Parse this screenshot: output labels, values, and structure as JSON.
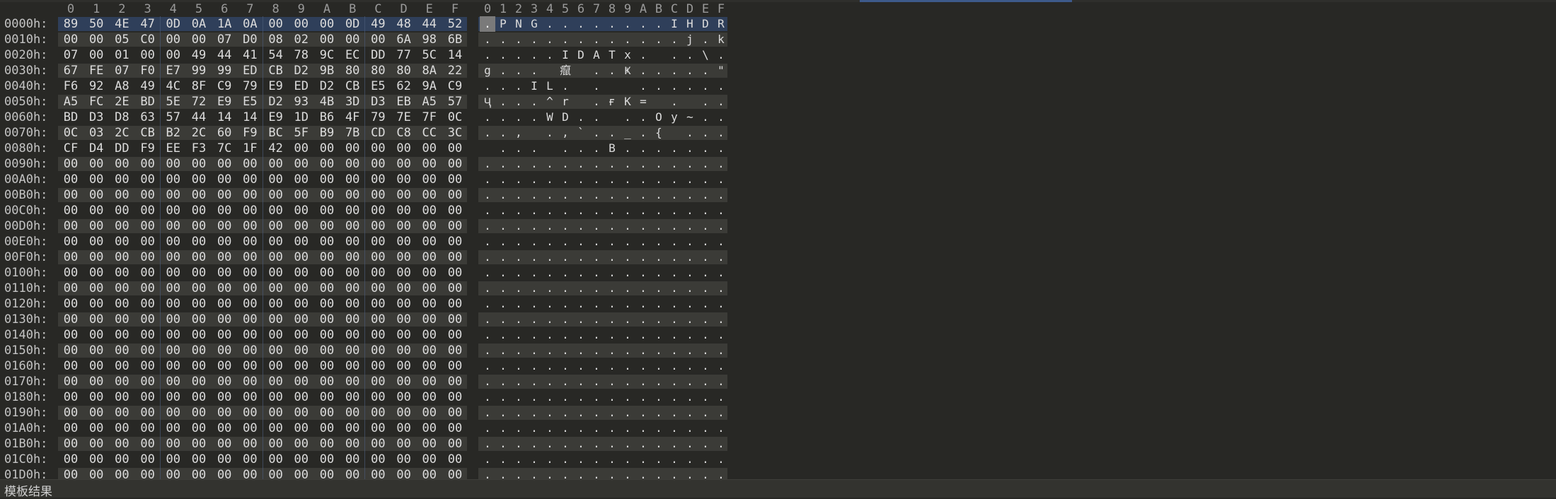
{
  "hex_columns": [
    "0",
    "1",
    "2",
    "3",
    "4",
    "5",
    "6",
    "7",
    "8",
    "9",
    "A",
    "B",
    "C",
    "D",
    "E",
    "F"
  ],
  "ascii_columns": [
    "0",
    "1",
    "2",
    "3",
    "4",
    "5",
    "6",
    "7",
    "8",
    "9",
    "A",
    "B",
    "C",
    "D",
    "E",
    "F"
  ],
  "rows": [
    {
      "offset": "0000h:",
      "bytes": [
        "89",
        "50",
        "4E",
        "47",
        "0D",
        "0A",
        "1A",
        "0A",
        "00",
        "00",
        "00",
        "0D",
        "49",
        "48",
        "44",
        "52"
      ],
      "ascii": [
        ".",
        " P",
        "N",
        "G",
        ".",
        ".",
        ".",
        ".",
        ".",
        ".",
        ".",
        ".",
        "I",
        "H",
        "D",
        "R"
      ]
    },
    {
      "offset": "0010h:",
      "bytes": [
        "00",
        "00",
        "05",
        "C0",
        "00",
        "00",
        "07",
        "D0",
        "08",
        "02",
        "00",
        "00",
        "00",
        "6A",
        "98",
        "6B"
      ],
      "ascii": [
        ".",
        ".",
        ".",
        ".",
        ".",
        ".",
        ".",
        ".",
        ".",
        ".",
        ".",
        ".",
        ".",
        "j",
        ".",
        "k"
      ]
    },
    {
      "offset": "0020h:",
      "bytes": [
        "07",
        "00",
        "01",
        "00",
        "00",
        "49",
        "44",
        "41",
        "54",
        "78",
        "9C",
        "EC",
        "DD",
        "77",
        "5C",
        "14"
      ],
      "ascii": [
        ".",
        ".",
        ".",
        ".",
        ".",
        "I",
        "D",
        "A",
        "T",
        "x",
        ".",
        "",
        ".",
        ".",
        "\\",
        "."
      ]
    },
    {
      "offset": "0030h:",
      "bytes": [
        "67",
        "FE",
        "07",
        "F0",
        "E7",
        "99",
        "99",
        "ED",
        "CB",
        "D2",
        "9B",
        "80",
        "80",
        "80",
        "8A",
        "22"
      ],
      "ascii": [
        "g",
        ".",
        ".",
        ".",
        "",
        "癙",
        "",
        ".",
        ".",
        "Ҝ",
        ".",
        ".",
        ".",
        ".",
        ".",
        "\""
      ]
    },
    {
      "offset": "0040h:",
      "bytes": [
        "F6",
        "92",
        "A8",
        "49",
        "4C",
        "8F",
        "C9",
        "79",
        "E9",
        "ED",
        "D2",
        "CB",
        "E5",
        "62",
        "9A",
        "C9"
      ],
      "ascii": [
        ".",
        ".",
        ".",
        "I",
        "L",
        ".",
        "",
        ".",
        "",
        "",
        ".",
        ".",
        ".",
        ".",
        ".",
        "."
      ]
    },
    {
      "offset": "0050h:",
      "bytes": [
        "A5",
        "FC",
        "2E",
        "BD",
        "5E",
        "72",
        "E9",
        "E5",
        "D2",
        "93",
        "4B",
        "3D",
        "D3",
        "EB",
        "A5",
        "57"
      ],
      "ascii": [
        "Ҷ",
        ".",
        ".",
        ".",
        "^",
        "r",
        "",
        ".",
        "ғ",
        "K",
        "=",
        "",
        ".",
        "",
        ".",
        "."
      ]
    },
    {
      "offset": "0060h:",
      "bytes": [
        "BD",
        "D3",
        "D8",
        "63",
        "57",
        "44",
        "14",
        "14",
        "E9",
        "1D",
        "B6",
        "4F",
        "79",
        "7E",
        "7F",
        "0C"
      ],
      "ascii": [
        ".",
        ".",
        ".",
        ".",
        "W",
        "D",
        ".",
        ".",
        "",
        ".",
        ".",
        "O",
        "y",
        "~",
        ".",
        "."
      ]
    },
    {
      "offset": "0070h:",
      "bytes": [
        "0C",
        "03",
        "2C",
        "CB",
        "B2",
        "2C",
        "60",
        "F9",
        "BC",
        "5F",
        "B9",
        "7B",
        "CD",
        "C8",
        "CC",
        "3C"
      ],
      "ascii": [
        ".",
        ".",
        ",",
        "",
        ".",
        ",",
        "`",
        ".",
        ".",
        "_",
        ".",
        "{",
        "",
        ".",
        ".",
        "."
      ]
    },
    {
      "offset": "0080h:",
      "bytes": [
        "CF",
        "D4",
        "DD",
        "F9",
        "EE",
        "F3",
        "7C",
        "1F",
        "42",
        "00",
        "00",
        "00",
        "00",
        "00",
        "00",
        "00"
      ],
      "ascii": [
        "",
        ".",
        ".",
        ".",
        "",
        ".",
        ".",
        ".",
        "B",
        ".",
        ".",
        ".",
        ".",
        ".",
        ".",
        "."
      ]
    },
    {
      "offset": "0090h:",
      "bytes": [
        "00",
        "00",
        "00",
        "00",
        "00",
        "00",
        "00",
        "00",
        "00",
        "00",
        "00",
        "00",
        "00",
        "00",
        "00",
        "00"
      ],
      "ascii": [
        ".",
        ".",
        ".",
        ".",
        ".",
        ".",
        ".",
        ".",
        ".",
        ".",
        ".",
        ".",
        ".",
        ".",
        ".",
        "."
      ]
    },
    {
      "offset": "00A0h:",
      "bytes": [
        "00",
        "00",
        "00",
        "00",
        "00",
        "00",
        "00",
        "00",
        "00",
        "00",
        "00",
        "00",
        "00",
        "00",
        "00",
        "00"
      ],
      "ascii": [
        ".",
        ".",
        ".",
        ".",
        ".",
        ".",
        ".",
        ".",
        ".",
        ".",
        ".",
        ".",
        ".",
        ".",
        ".",
        "."
      ]
    },
    {
      "offset": "00B0h:",
      "bytes": [
        "00",
        "00",
        "00",
        "00",
        "00",
        "00",
        "00",
        "00",
        "00",
        "00",
        "00",
        "00",
        "00",
        "00",
        "00",
        "00"
      ],
      "ascii": [
        ".",
        ".",
        ".",
        ".",
        ".",
        ".",
        ".",
        ".",
        ".",
        ".",
        ".",
        ".",
        ".",
        ".",
        ".",
        "."
      ]
    },
    {
      "offset": "00C0h:",
      "bytes": [
        "00",
        "00",
        "00",
        "00",
        "00",
        "00",
        "00",
        "00",
        "00",
        "00",
        "00",
        "00",
        "00",
        "00",
        "00",
        "00"
      ],
      "ascii": [
        ".",
        ".",
        ".",
        ".",
        ".",
        ".",
        ".",
        ".",
        ".",
        ".",
        ".",
        ".",
        ".",
        ".",
        ".",
        "."
      ]
    },
    {
      "offset": "00D0h:",
      "bytes": [
        "00",
        "00",
        "00",
        "00",
        "00",
        "00",
        "00",
        "00",
        "00",
        "00",
        "00",
        "00",
        "00",
        "00",
        "00",
        "00"
      ],
      "ascii": [
        ".",
        ".",
        ".",
        ".",
        ".",
        ".",
        ".",
        ".",
        ".",
        ".",
        ".",
        ".",
        ".",
        ".",
        ".",
        "."
      ]
    },
    {
      "offset": "00E0h:",
      "bytes": [
        "00",
        "00",
        "00",
        "00",
        "00",
        "00",
        "00",
        "00",
        "00",
        "00",
        "00",
        "00",
        "00",
        "00",
        "00",
        "00"
      ],
      "ascii": [
        ".",
        ".",
        ".",
        ".",
        ".",
        ".",
        ".",
        ".",
        ".",
        ".",
        ".",
        ".",
        ".",
        ".",
        ".",
        "."
      ]
    },
    {
      "offset": "00F0h:",
      "bytes": [
        "00",
        "00",
        "00",
        "00",
        "00",
        "00",
        "00",
        "00",
        "00",
        "00",
        "00",
        "00",
        "00",
        "00",
        "00",
        "00"
      ],
      "ascii": [
        ".",
        ".",
        ".",
        ".",
        ".",
        ".",
        ".",
        ".",
        ".",
        ".",
        ".",
        ".",
        ".",
        ".",
        ".",
        "."
      ]
    },
    {
      "offset": "0100h:",
      "bytes": [
        "00",
        "00",
        "00",
        "00",
        "00",
        "00",
        "00",
        "00",
        "00",
        "00",
        "00",
        "00",
        "00",
        "00",
        "00",
        "00"
      ],
      "ascii": [
        ".",
        ".",
        ".",
        ".",
        ".",
        ".",
        ".",
        ".",
        ".",
        ".",
        ".",
        ".",
        ".",
        ".",
        ".",
        "."
      ]
    },
    {
      "offset": "0110h:",
      "bytes": [
        "00",
        "00",
        "00",
        "00",
        "00",
        "00",
        "00",
        "00",
        "00",
        "00",
        "00",
        "00",
        "00",
        "00",
        "00",
        "00"
      ],
      "ascii": [
        ".",
        ".",
        ".",
        ".",
        ".",
        ".",
        ".",
        ".",
        ".",
        ".",
        ".",
        ".",
        ".",
        ".",
        ".",
        "."
      ]
    },
    {
      "offset": "0120h:",
      "bytes": [
        "00",
        "00",
        "00",
        "00",
        "00",
        "00",
        "00",
        "00",
        "00",
        "00",
        "00",
        "00",
        "00",
        "00",
        "00",
        "00"
      ],
      "ascii": [
        ".",
        ".",
        ".",
        ".",
        ".",
        ".",
        ".",
        ".",
        ".",
        ".",
        ".",
        ".",
        ".",
        ".",
        ".",
        "."
      ]
    },
    {
      "offset": "0130h:",
      "bytes": [
        "00",
        "00",
        "00",
        "00",
        "00",
        "00",
        "00",
        "00",
        "00",
        "00",
        "00",
        "00",
        "00",
        "00",
        "00",
        "00"
      ],
      "ascii": [
        ".",
        ".",
        ".",
        ".",
        ".",
        ".",
        ".",
        ".",
        ".",
        ".",
        ".",
        ".",
        ".",
        ".",
        ".",
        "."
      ]
    },
    {
      "offset": "0140h:",
      "bytes": [
        "00",
        "00",
        "00",
        "00",
        "00",
        "00",
        "00",
        "00",
        "00",
        "00",
        "00",
        "00",
        "00",
        "00",
        "00",
        "00"
      ],
      "ascii": [
        ".",
        ".",
        ".",
        ".",
        ".",
        ".",
        ".",
        ".",
        ".",
        ".",
        ".",
        ".",
        ".",
        ".",
        ".",
        "."
      ]
    },
    {
      "offset": "0150h:",
      "bytes": [
        "00",
        "00",
        "00",
        "00",
        "00",
        "00",
        "00",
        "00",
        "00",
        "00",
        "00",
        "00",
        "00",
        "00",
        "00",
        "00"
      ],
      "ascii": [
        ".",
        ".",
        ".",
        ".",
        ".",
        ".",
        ".",
        ".",
        ".",
        ".",
        ".",
        ".",
        ".",
        ".",
        ".",
        "."
      ]
    },
    {
      "offset": "0160h:",
      "bytes": [
        "00",
        "00",
        "00",
        "00",
        "00",
        "00",
        "00",
        "00",
        "00",
        "00",
        "00",
        "00",
        "00",
        "00",
        "00",
        "00"
      ],
      "ascii": [
        ".",
        ".",
        ".",
        ".",
        ".",
        ".",
        ".",
        ".",
        ".",
        ".",
        ".",
        ".",
        ".",
        ".",
        ".",
        "."
      ]
    },
    {
      "offset": "0170h:",
      "bytes": [
        "00",
        "00",
        "00",
        "00",
        "00",
        "00",
        "00",
        "00",
        "00",
        "00",
        "00",
        "00",
        "00",
        "00",
        "00",
        "00"
      ],
      "ascii": [
        ".",
        ".",
        ".",
        ".",
        ".",
        ".",
        ".",
        ".",
        ".",
        ".",
        ".",
        ".",
        ".",
        ".",
        ".",
        "."
      ]
    },
    {
      "offset": "0180h:",
      "bytes": [
        "00",
        "00",
        "00",
        "00",
        "00",
        "00",
        "00",
        "00",
        "00",
        "00",
        "00",
        "00",
        "00",
        "00",
        "00",
        "00"
      ],
      "ascii": [
        ".",
        ".",
        ".",
        ".",
        ".",
        ".",
        ".",
        ".",
        ".",
        ".",
        ".",
        ".",
        ".",
        ".",
        ".",
        "."
      ]
    },
    {
      "offset": "0190h:",
      "bytes": [
        "00",
        "00",
        "00",
        "00",
        "00",
        "00",
        "00",
        "00",
        "00",
        "00",
        "00",
        "00",
        "00",
        "00",
        "00",
        "00"
      ],
      "ascii": [
        ".",
        ".",
        ".",
        ".",
        ".",
        ".",
        ".",
        ".",
        ".",
        ".",
        ".",
        ".",
        ".",
        ".",
        ".",
        "."
      ]
    },
    {
      "offset": "01A0h:",
      "bytes": [
        "00",
        "00",
        "00",
        "00",
        "00",
        "00",
        "00",
        "00",
        "00",
        "00",
        "00",
        "00",
        "00",
        "00",
        "00",
        "00"
      ],
      "ascii": [
        ".",
        ".",
        ".",
        ".",
        ".",
        ".",
        ".",
        ".",
        ".",
        ".",
        ".",
        ".",
        ".",
        ".",
        ".",
        "."
      ]
    },
    {
      "offset": "01B0h:",
      "bytes": [
        "00",
        "00",
        "00",
        "00",
        "00",
        "00",
        "00",
        "00",
        "00",
        "00",
        "00",
        "00",
        "00",
        "00",
        "00",
        "00"
      ],
      "ascii": [
        ".",
        ".",
        ".",
        ".",
        ".",
        ".",
        ".",
        ".",
        ".",
        ".",
        ".",
        ".",
        ".",
        ".",
        ".",
        "."
      ]
    },
    {
      "offset": "01C0h:",
      "bytes": [
        "00",
        "00",
        "00",
        "00",
        "00",
        "00",
        "00",
        "00",
        "00",
        "00",
        "00",
        "00",
        "00",
        "00",
        "00",
        "00"
      ],
      "ascii": [
        ".",
        ".",
        ".",
        ".",
        ".",
        ".",
        ".",
        ".",
        ".",
        ".",
        ".",
        ".",
        ".",
        ".",
        ".",
        "."
      ]
    },
    {
      "offset": "01D0h:",
      "bytes": [
        "00",
        "00",
        "00",
        "00",
        "00",
        "00",
        "00",
        "00",
        "00",
        "00",
        "00",
        "00",
        "00",
        "00",
        "00",
        "00"
      ],
      "ascii": [
        ".",
        ".",
        ".",
        ".",
        ".",
        ".",
        ".",
        ".",
        ".",
        ".",
        ".",
        ".",
        ".",
        ".",
        ".",
        "."
      ]
    }
  ],
  "status_bar": {
    "label": "模板结果"
  },
  "colors": {
    "background": "#282825",
    "stripe": "#3b3b37",
    "selection": "#2f3f5a",
    "text": "#dcdcdc"
  }
}
